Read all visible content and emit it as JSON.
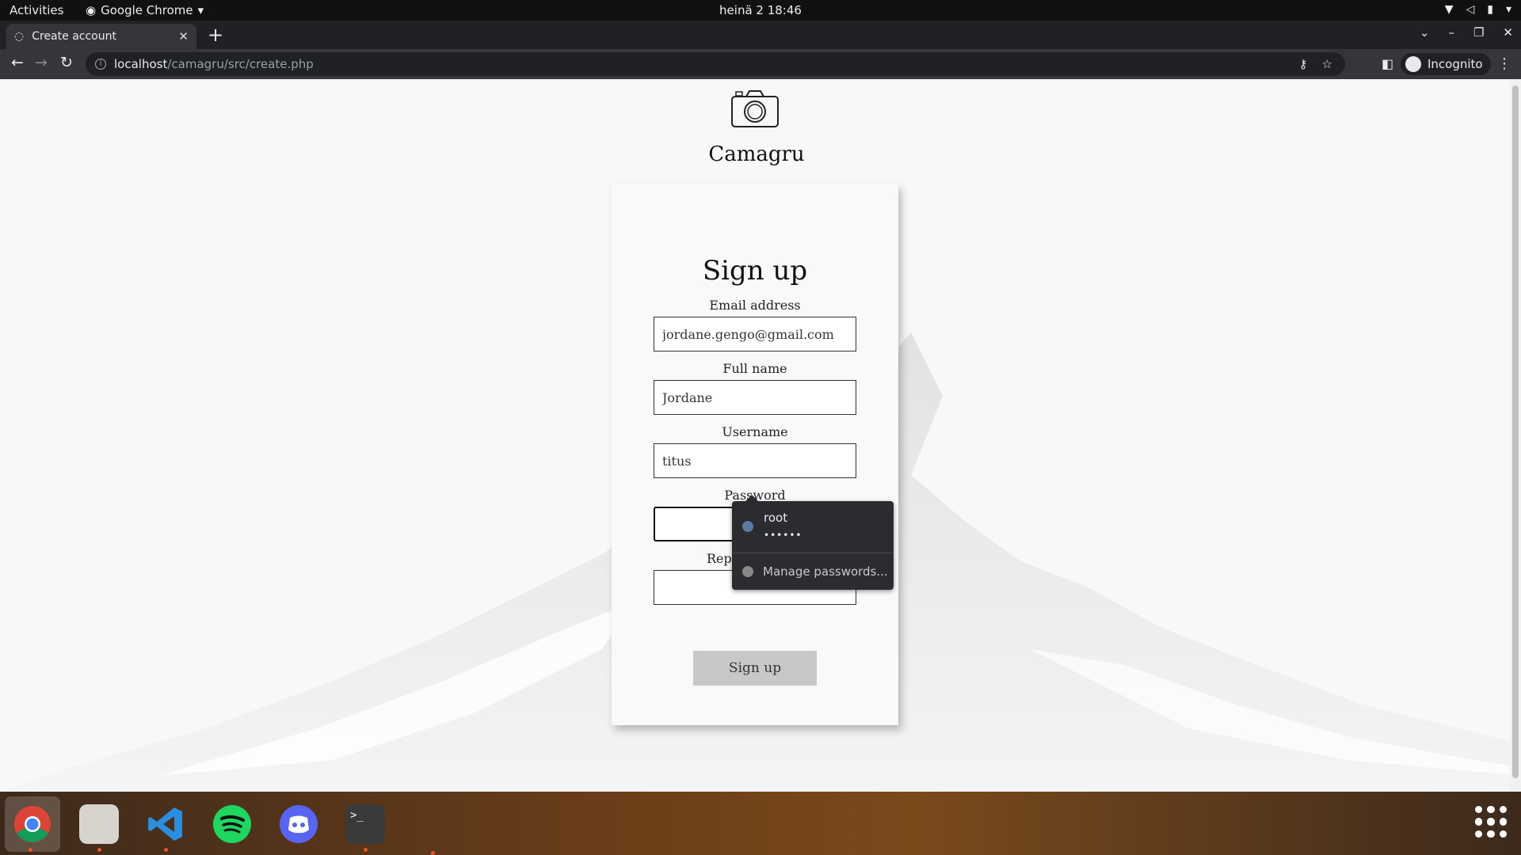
{
  "topbar": {
    "activities": "Activities",
    "app_name": "Google Chrome",
    "clock": "heinä 2  18:46"
  },
  "browser": {
    "tab_title": "Create account",
    "url_host": "localhost",
    "url_path": "/camagru/src/create.php",
    "profile_label": "Incognito"
  },
  "page": {
    "brand": "Camagru",
    "heading": "Sign up",
    "fields": {
      "email_label": "Email address",
      "email_value": "jordane.gengo@gmail.com",
      "fullname_label": "Full name",
      "fullname_value": "Jordane",
      "username_label": "Username",
      "username_value": "titus",
      "password_label": "Password",
      "password_value": "",
      "repeat_label": "Repe",
      "repeat_value": ""
    },
    "submit_label": "Sign up"
  },
  "autofill": {
    "username": "root",
    "password_mask": "••••••",
    "manage_label": "Manage passwords..."
  },
  "dock": {
    "apps": [
      "chrome-icon",
      "files-icon",
      "vscode-icon",
      "spotify-icon",
      "discord-icon",
      "terminal-icon"
    ]
  }
}
